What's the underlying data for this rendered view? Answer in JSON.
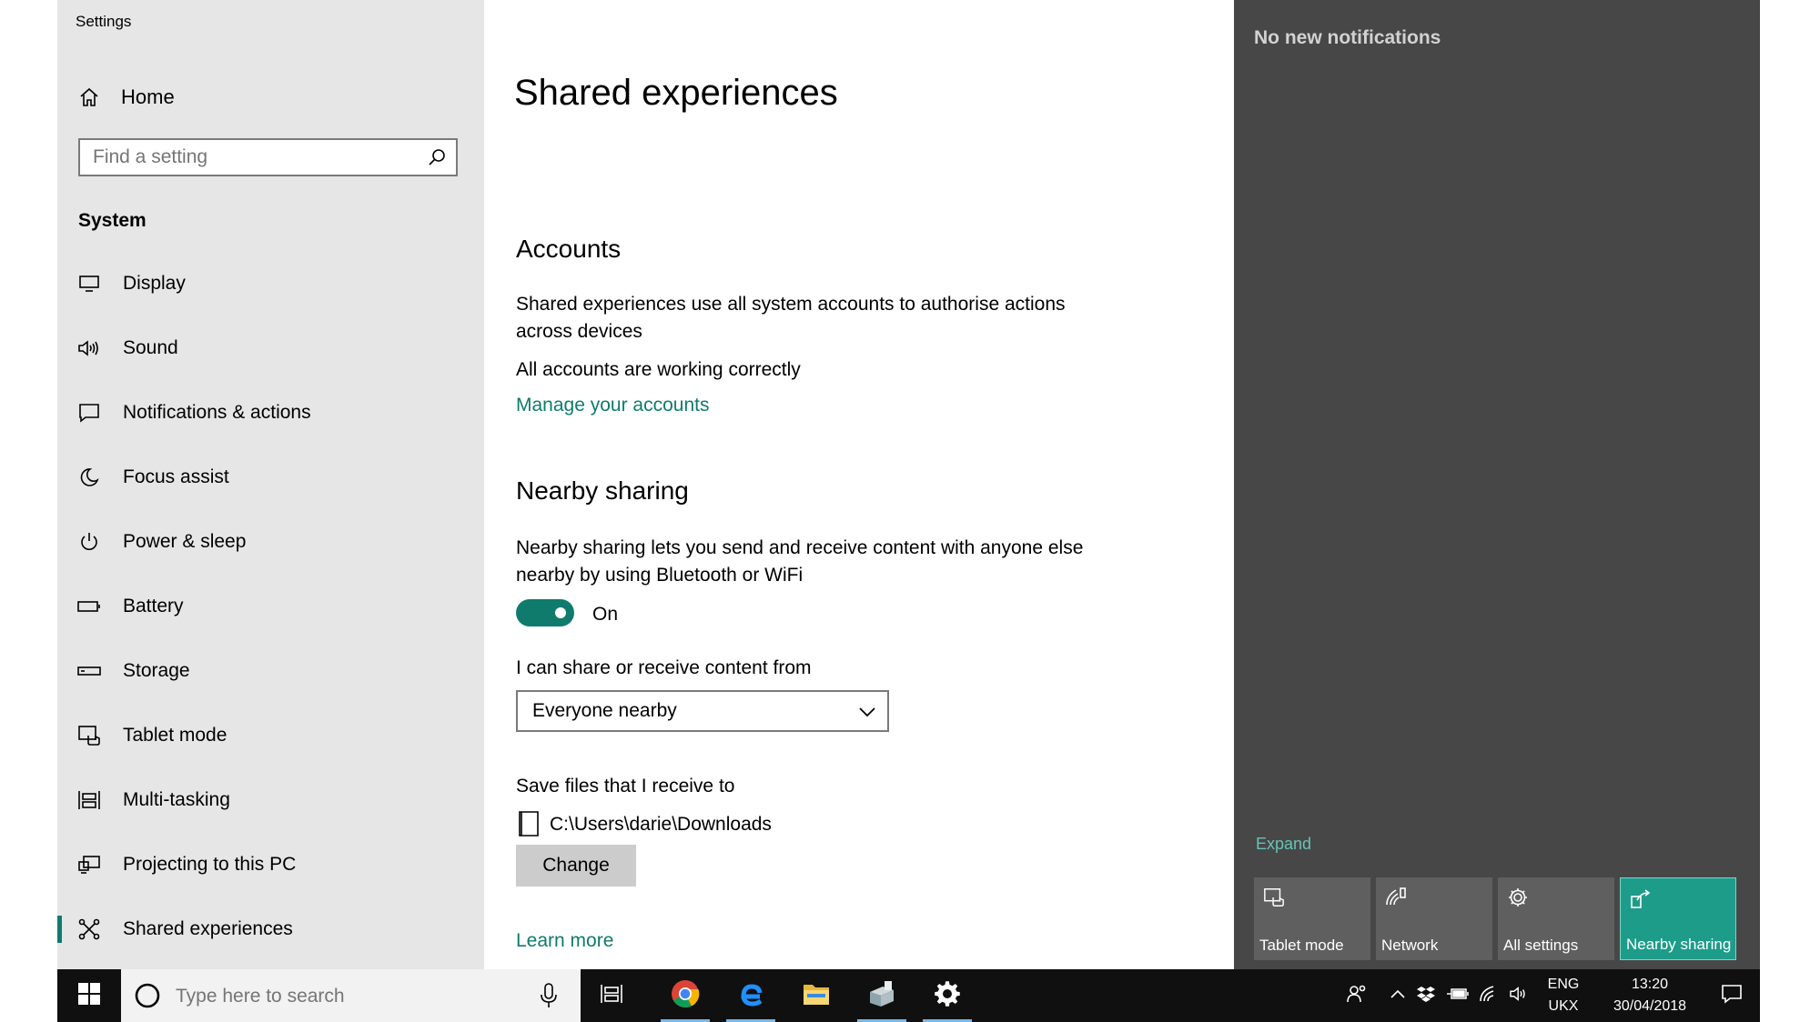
{
  "sidebar": {
    "app_title": "Settings",
    "home_label": "Home",
    "search_placeholder": "Find a setting",
    "section_label": "System",
    "items": [
      {
        "label": "Display",
        "icon": "monitor-icon"
      },
      {
        "label": "Sound",
        "icon": "speaker-icon"
      },
      {
        "label": "Notifications & actions",
        "icon": "message-icon"
      },
      {
        "label": "Focus assist",
        "icon": "moon-icon"
      },
      {
        "label": "Power & sleep",
        "icon": "power-icon"
      },
      {
        "label": "Battery",
        "icon": "battery-icon"
      },
      {
        "label": "Storage",
        "icon": "storage-icon"
      },
      {
        "label": "Tablet mode",
        "icon": "tablet-mode-icon"
      },
      {
        "label": "Multi-tasking",
        "icon": "multitasking-icon"
      },
      {
        "label": "Projecting to this PC",
        "icon": "projecting-icon"
      },
      {
        "label": "Shared experiences",
        "icon": "shared-experiences-icon",
        "active": true
      }
    ]
  },
  "main": {
    "title": "Shared experiences",
    "accounts": {
      "heading": "Accounts",
      "desc_line1": "Shared experiences use all system accounts to authorise actions",
      "desc_line2": "across devices",
      "status": "All accounts are working correctly",
      "manage_link": "Manage your accounts"
    },
    "nearby": {
      "heading": "Nearby sharing",
      "desc_line1": "Nearby sharing lets you send and receive content with anyone else",
      "desc_line2": "nearby by using Bluetooth or WiFi",
      "toggle_state": "On",
      "share_from_label": "I can share or receive content from",
      "share_from_value": "Everyone nearby",
      "save_label": "Save files that I receive to",
      "save_path": "C:\\Users\\darie\\Downloads",
      "change_button": "Change",
      "learn_more": "Learn more"
    }
  },
  "action_center": {
    "no_notifications": "No new notifications",
    "expand": "Expand",
    "tiles": [
      {
        "label": "Tablet mode",
        "icon": "tablet-mode-icon",
        "active": false
      },
      {
        "label": "Network",
        "icon": "network-icon",
        "active": false
      },
      {
        "label": "All settings",
        "icon": "gear-icon",
        "active": false
      },
      {
        "label": "Nearby sharing",
        "icon": "nearby-sharing-icon",
        "active": true
      }
    ]
  },
  "taskbar": {
    "search_placeholder": "Type here to search",
    "apps": [
      "task-view-icon",
      "chrome-icon",
      "edge-icon",
      "file-explorer-icon",
      "network-app-icon",
      "settings-icon"
    ],
    "language_line1": "ENG",
    "language_line2": "UKX",
    "time": "13:20",
    "date": "30/04/2018"
  },
  "colors": {
    "accent": "#0f7b6c",
    "sidebar_bg": "#e6e6e6",
    "action_center_bg": "#474747",
    "taskbar_bg": "#101010",
    "active_tile": "#1d9c8a"
  }
}
